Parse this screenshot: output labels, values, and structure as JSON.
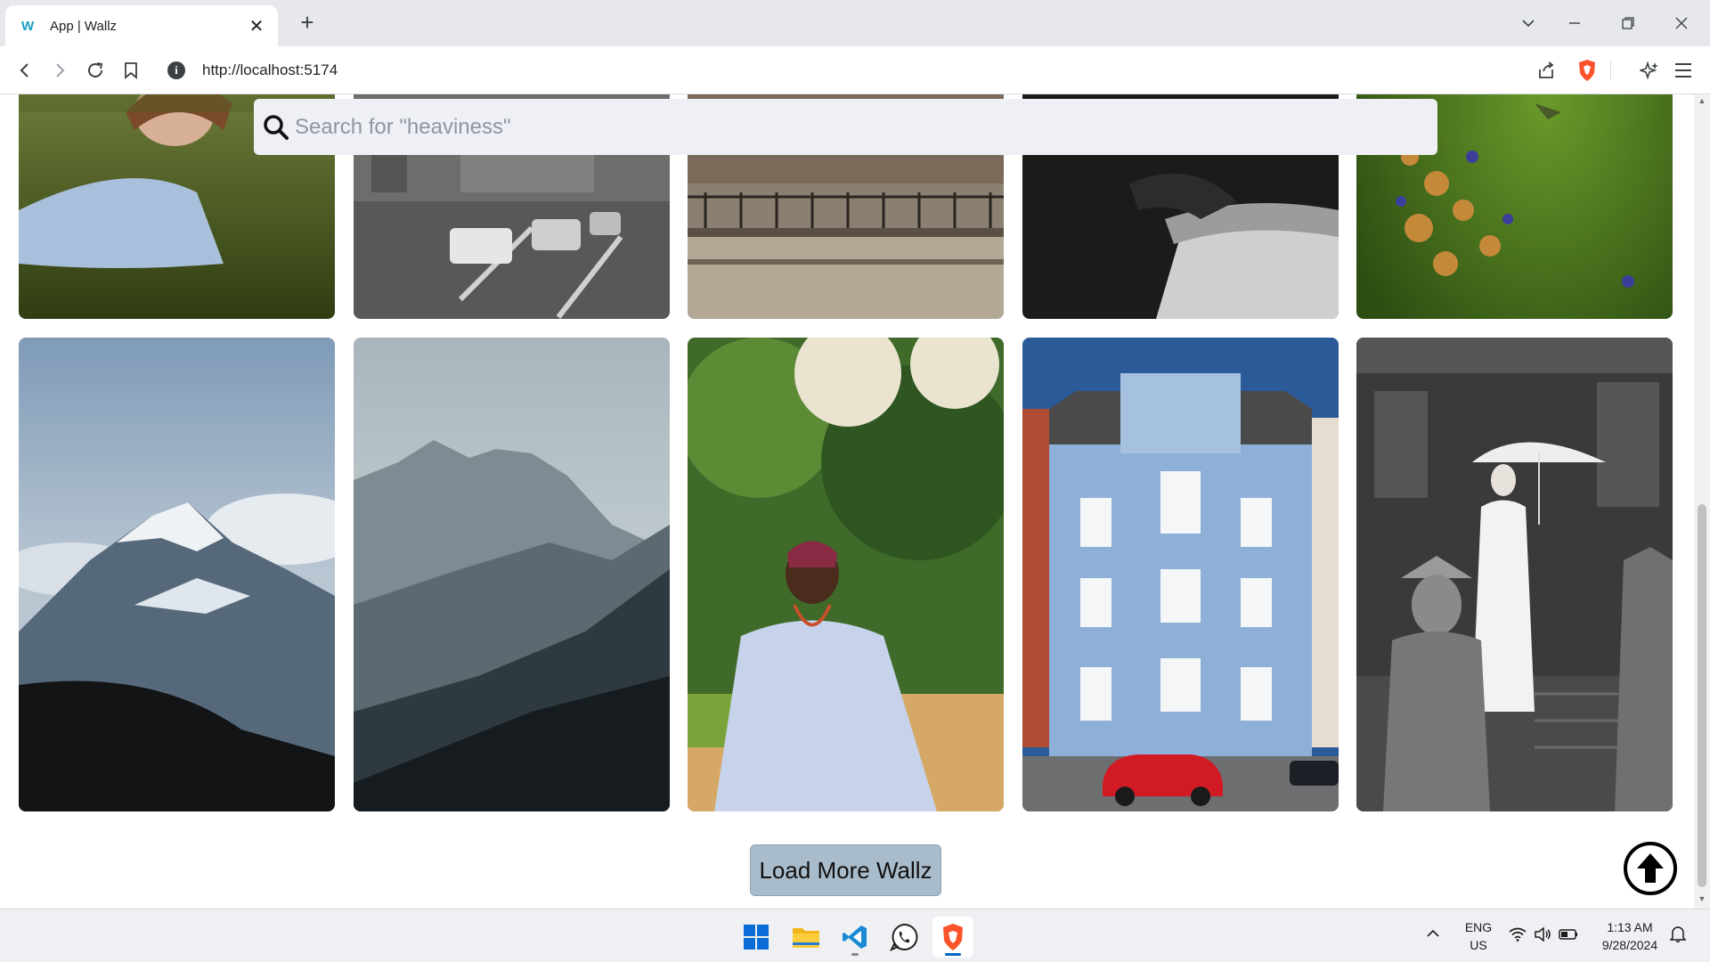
{
  "browser": {
    "favicon_text": "W",
    "tab_title": "App | Wallz",
    "tab_close": "✕",
    "new_tab": "+",
    "url": "http://localhost:5174"
  },
  "page": {
    "search_placeholder": "Search for \"heaviness\"",
    "load_more_label": "Load More Wallz",
    "photos_row1": [
      "man-lying-on-grass",
      "black-and-white-city-street",
      "city-traffic-railing",
      "black-and-white-hand-railing",
      "hummingbird-and-flowers"
    ],
    "photos_row2": [
      "snowy-mountain-clouds",
      "misty-mountain-ridge",
      "man-in-traditional-attire",
      "blue-building-red-car",
      "woman-with-umbrella-statues"
    ]
  },
  "taskbar": {
    "apps": [
      "windows-start",
      "file-explorer",
      "vs-code",
      "whatsapp",
      "brave-browser"
    ],
    "language_top": "ENG",
    "language_bottom": "US",
    "time": "1:13 AM",
    "date": "9/28/2024"
  },
  "colors": {
    "accent": "#0067c0",
    "load_more_bg": "#a9bccb",
    "search_bg": "#eef0f6"
  }
}
